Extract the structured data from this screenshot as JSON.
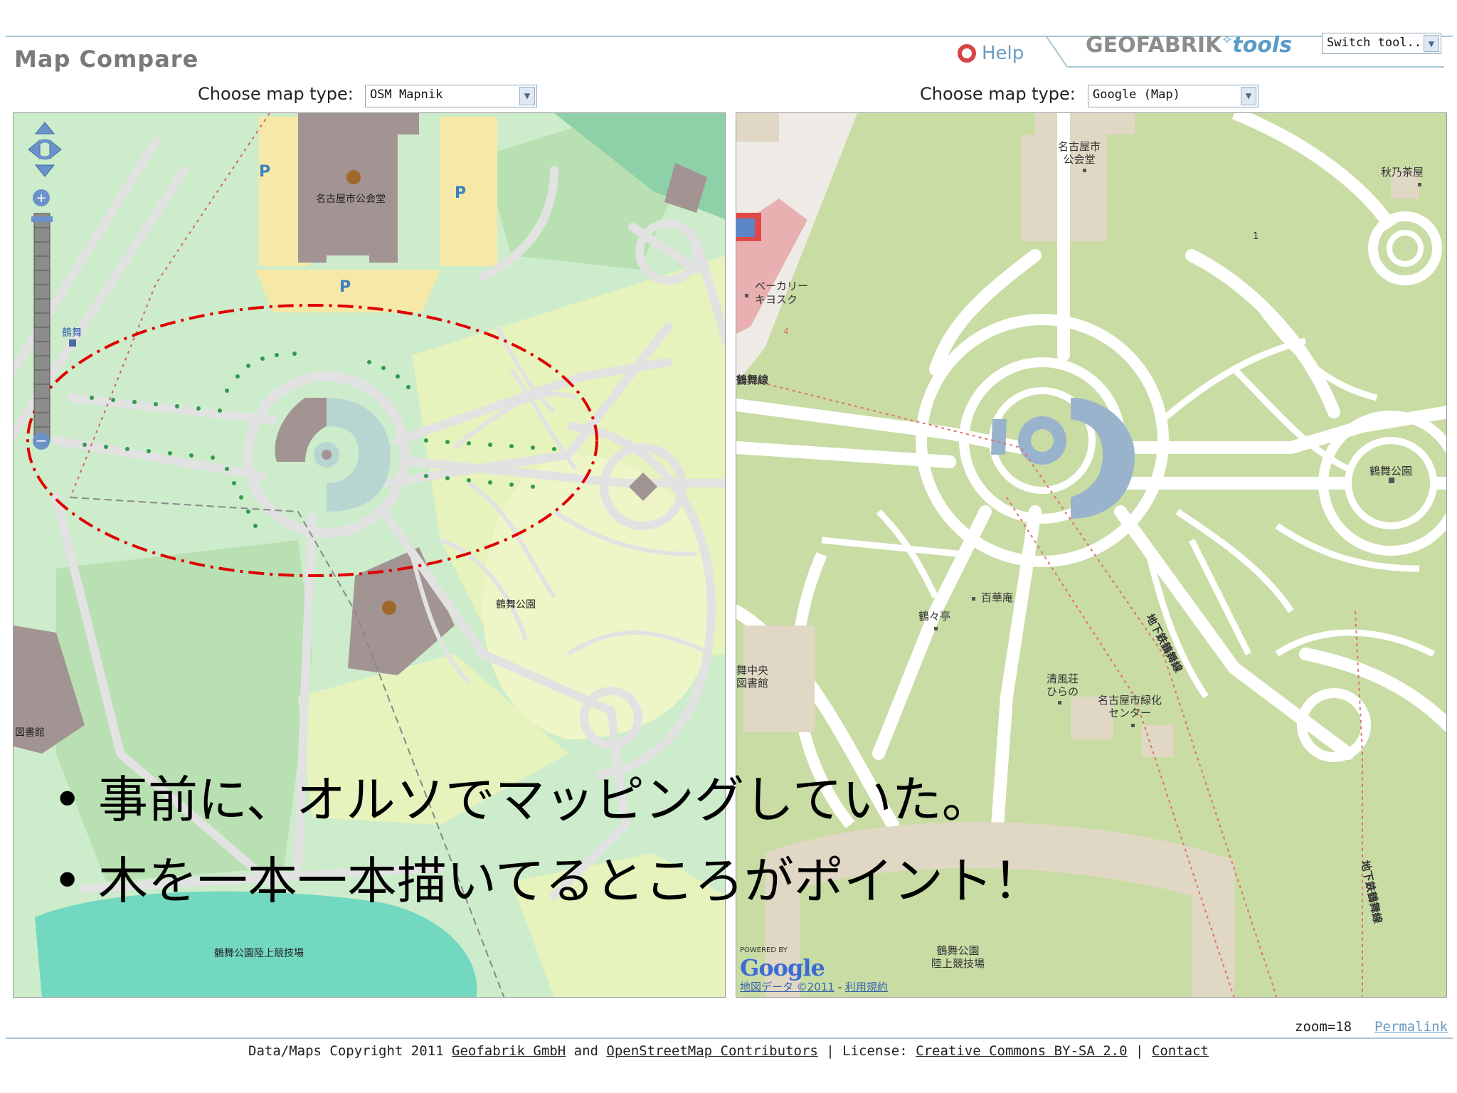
{
  "header": {
    "app_title": "Map Compare",
    "help_label": "Help",
    "brand_name": "GEOFABRIK",
    "brand_tools": "tools",
    "switch_tool": "Switch tool..."
  },
  "left_panel": {
    "choose_label": "Choose map type:",
    "map_type": "OSM Mapnik",
    "labels": {
      "hall": "名古屋市公会堂",
      "parking": "P",
      "tsuruma_station": "鶴舞",
      "park": "鶴舞公園",
      "stadium": "鶴舞公園陸上競技場",
      "library": "図書館"
    }
  },
  "right_panel": {
    "choose_label": "Choose map type:",
    "map_type": "Google (Map)",
    "labels": {
      "hall_line1": "名古屋市",
      "hall_line2": "公会堂",
      "teahouse": "秋乃茶屋",
      "bakery_line1": "ベーカリー",
      "bakery_line2": "キヨスク",
      "rail_line": "鶴舞線",
      "park": "鶴舞公園",
      "hyakkatei": "百華庵",
      "tsurutei": "鶴々亭",
      "subway_line": "地下鉄鶴舞線",
      "seifuso_line1": "清風荘",
      "seifuso_line2": "ひらの",
      "greening_line1": "名古屋市緑化",
      "greening_line2": "センター",
      "library_line1": "舞中央",
      "library_line2": "図書館",
      "stadium_line1": "鶴舞公園",
      "stadium_line2": "陸上競技場",
      "marker_1": "1",
      "marker_4": "4",
      "powered_by": "POWERED BY",
      "google_logo": "Google",
      "map_data": "地図データ ©2011",
      "terms": "利用規約"
    }
  },
  "slide": {
    "bullet_1": "事前に、オルソでマッピングしていた。",
    "bullet_2": "木を一本一本描いてるところがポイント！",
    "bullet_symbol": "•"
  },
  "footer": {
    "zoom": "zoom=18",
    "permalink": "Permalink",
    "copyright_prefix": "Data/Maps Copyright 2011",
    "geofabrik": "Geofabrik GmbH",
    "and": "and",
    "osm": "OpenStreetMap Contributors",
    "license_label": "| License:",
    "license": "Creative Commons BY-SA 2.0",
    "sep": "|",
    "contact": "Contact"
  },
  "colors": {
    "osm_park": "#cdeccb",
    "osm_garden": "#e6f3bd",
    "osm_pitch": "#8ed0a8",
    "osm_water": "#72d8bf",
    "osm_building": "#a29493",
    "osm_parking": "#f6e9a8",
    "google_green": "#c8dca4",
    "google_road": "#ffffff",
    "google_building": "#e0d8c4",
    "google_water": "#99b3cc",
    "highlight_ellipse": "#e00000"
  }
}
